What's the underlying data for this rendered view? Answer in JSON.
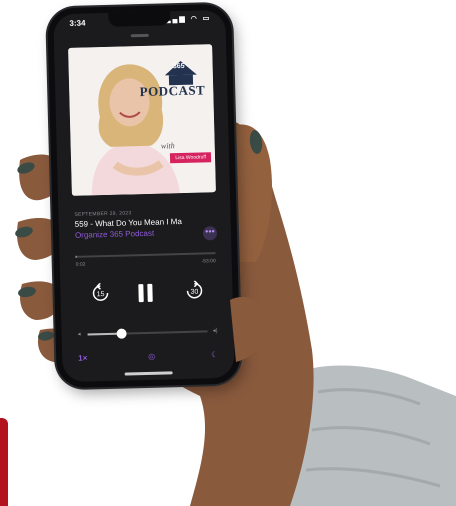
{
  "status": {
    "time": "3:34",
    "icons": "signal-wifi-battery"
  },
  "artwork": {
    "logo_number": "365",
    "podcast_word": "PODCAST",
    "with_text": "with",
    "host_name": "Lisa Woodruff"
  },
  "episode": {
    "date": "SEPTEMBER 29, 2023",
    "title": "559 - What Do You Mean I Ma",
    "show": "Organize 365 Podcast",
    "more_label": "•••"
  },
  "playback": {
    "elapsed": "0:02",
    "remaining": "-53:00",
    "progress_fraction": 0.01,
    "skip_back_seconds": "15",
    "skip_forward_seconds": "30",
    "volume_fraction": 0.28
  },
  "bottom": {
    "speed": "1×"
  },
  "colors": {
    "accent": "#8f5bd8",
    "brand_pink": "#d6225f",
    "brand_navy": "#23334f",
    "red_block": "#b3121f",
    "nail": "#3a4a44",
    "skin": "#8a5a3d",
    "sleeve": "#b9bec0"
  },
  "icons": [
    "skip-back-15-icon",
    "pause-icon",
    "skip-forward-30-icon",
    "airplay-icon",
    "sleep-timer-icon",
    "volume-low-icon",
    "volume-high-icon"
  ]
}
